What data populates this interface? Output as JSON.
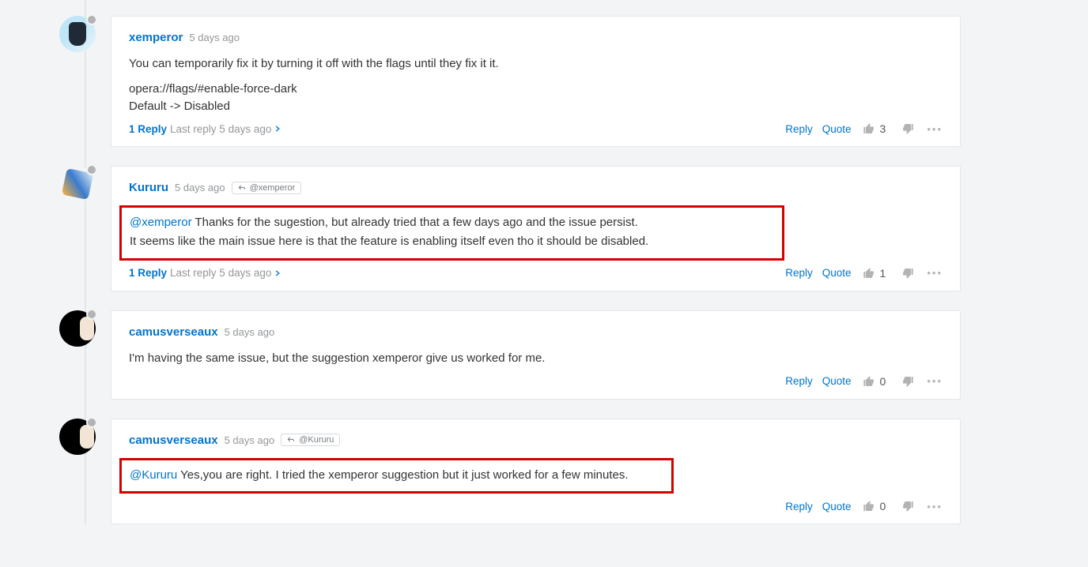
{
  "posts": [
    {
      "user": "xemperor",
      "time": "5 days ago",
      "body_lines": [
        "You can temporarily fix it by turning it off with the flags until they fix it it.",
        "opera://flags/#enable-force-dark\nDefault -> Disabled"
      ],
      "reply_count": "1 Reply",
      "last_reply": "Last reply 5 days ago",
      "upvotes": "3"
    },
    {
      "user": "Kururu",
      "time": "5 days ago",
      "reply_to": "@xemperor",
      "mention": "@xemperor",
      "body_lines": [
        " Thanks for the sugestion, but already tried that a few days ago and the issue persist.",
        "It seems like the main issue here is that the feature is enabling itself even tho it should be disabled."
      ],
      "reply_count": "1 Reply",
      "last_reply": "Last reply 5 days ago",
      "upvotes": "1"
    },
    {
      "user": "camusverseaux",
      "time": "5 days ago",
      "body_lines": [
        "I'm having the same issue, but the suggestion xemperor give us worked for me."
      ],
      "upvotes": "0"
    },
    {
      "user": "camusverseaux",
      "time": "5 days ago",
      "reply_to": "@Kururu",
      "mention": "@Kururu",
      "body_lines": [
        " Yes,you are right. I tried the xemperor suggestion but it just worked for a few minutes."
      ],
      "upvotes": "0"
    }
  ],
  "actions": {
    "reply": "Reply",
    "quote": "Quote"
  }
}
